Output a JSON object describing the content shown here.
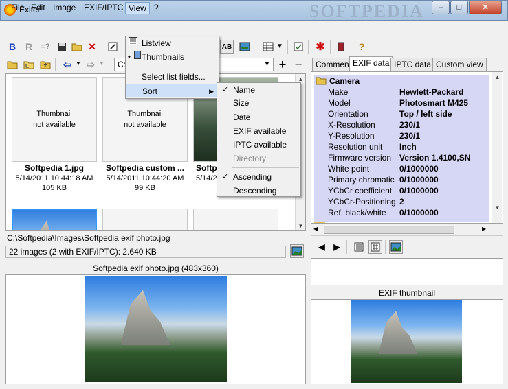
{
  "window": {
    "title": "Exifer",
    "watermark": "SOFTPEDIA",
    "min": "–",
    "max": "□",
    "close": "✕"
  },
  "menubar": [
    "File",
    "Edit",
    "Image",
    "EXIF/IPTC",
    "View",
    "?"
  ],
  "toolbar1": {
    "b": "B",
    "r": "R",
    "eq": "=?",
    "ab": "AB"
  },
  "toolbar2": {
    "path": "C:",
    "plus": "+",
    "minus": "−"
  },
  "thumbs": [
    {
      "line1": "Thumbnail",
      "line2": "not available",
      "name": "Softpedia 1.jpg",
      "date": "5/14/2011 10:44:18 AM",
      "size": "105 KB"
    },
    {
      "line1": "Thumbnail",
      "line2": "not available",
      "name": "Softpedia custom ...",
      "date": "5/14/2011 10:44:20 AM",
      "size": "99 KB"
    },
    {
      "name": "Softp",
      "date": "5/14/2"
    }
  ],
  "path_bar": "C:\\Softpedia\\Images\\Softpedia exif photo.jpg",
  "status_bar": "22 images (2 with EXIF/IPTC): 2.640 KB",
  "preview_caption": "Softpedia exif photo.jpg (483x360)",
  "tabs": [
    "Comment",
    "EXIF data",
    "IPTC data",
    "Custom view"
  ],
  "exif": {
    "group": "Camera",
    "rows": [
      [
        "Make",
        "Hewlett-Packard"
      ],
      [
        "Model",
        "Photosmart M425"
      ],
      [
        "Orientation",
        "Top / left side"
      ],
      [
        "X-Resolution",
        "230/1"
      ],
      [
        "Y-Resolution",
        "230/1"
      ],
      [
        "Resolution unit",
        "Inch"
      ],
      [
        "Firmware version",
        "Version 1.4100,SN"
      ],
      [
        "White point",
        "0/1000000"
      ],
      [
        "Primary chromatic",
        "0/1000000"
      ],
      [
        "YCbCr coefficient",
        "0/1000000"
      ],
      [
        "YCbCr-Positioning",
        "2"
      ],
      [
        "Ref. black/white",
        "0/1000000"
      ]
    ]
  },
  "exif_thumb_caption": "EXIF thumbnail",
  "view_menu": {
    "listview": "Listview",
    "thumbnails": "Thumbnails",
    "select": "Select list fields...",
    "sort": "Sort"
  },
  "sort_menu": {
    "name": "Name",
    "size": "Size",
    "date": "Date",
    "exif": "EXIF available",
    "iptc": "IPTC available",
    "directory": "Directory",
    "asc": "Ascending",
    "desc": "Descending"
  },
  "colors": {
    "accent": "#cde0f7",
    "exif_bg": "#d6d6f5"
  }
}
